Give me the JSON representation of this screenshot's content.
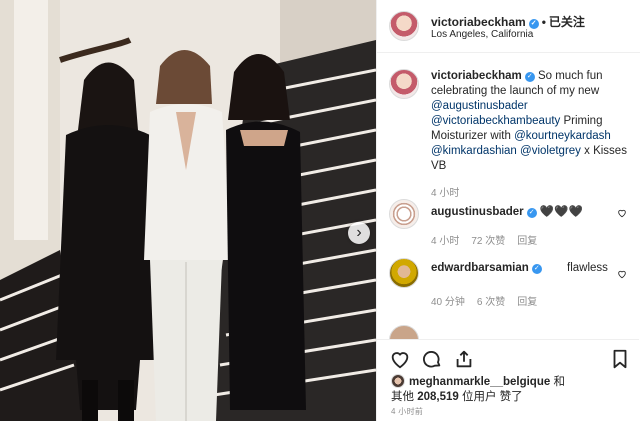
{
  "photo": {
    "alt": "",
    "next_button": "›"
  },
  "header": {
    "username": "victoriabeckham",
    "verified_mark": "✓",
    "separator": "•",
    "follow_status": "已关注",
    "location": "Los Angeles, California"
  },
  "caption": {
    "username": "victoriabeckham",
    "text_before": "So much fun celebrating the launch of my new ",
    "mention1": "@augustinusbader",
    "mention2": "@victoriabeckhambeauty",
    "text_mid": " Priming Moisturizer with ",
    "mention3": "@kourtneykardash",
    "mention4": "@kimkardashian",
    "mention5": "@violetgrey",
    "text_after": " x Kisses VB",
    "time": "4 小时"
  },
  "comments": [
    {
      "username": "augustinusbader",
      "text": "🖤🖤🖤",
      "time": "4 小时",
      "likes": "72 次赞",
      "reply": "回复"
    },
    {
      "username": "edwardbarsamian",
      "text": "flawless",
      "time": "40 分钟",
      "likes": "6 次赞",
      "reply": "回复"
    }
  ],
  "likes": {
    "liker": "meghanmarkle__belgique",
    "and": " 和",
    "others_prefix": "其他 ",
    "count": "208,519",
    "others_suffix": " 位用户 赞了"
  },
  "post_time": "4 小时前",
  "colors": {
    "verified": "#3897f0",
    "mention": "#003569",
    "meta": "#8e8e8e",
    "border": "#efefef"
  }
}
